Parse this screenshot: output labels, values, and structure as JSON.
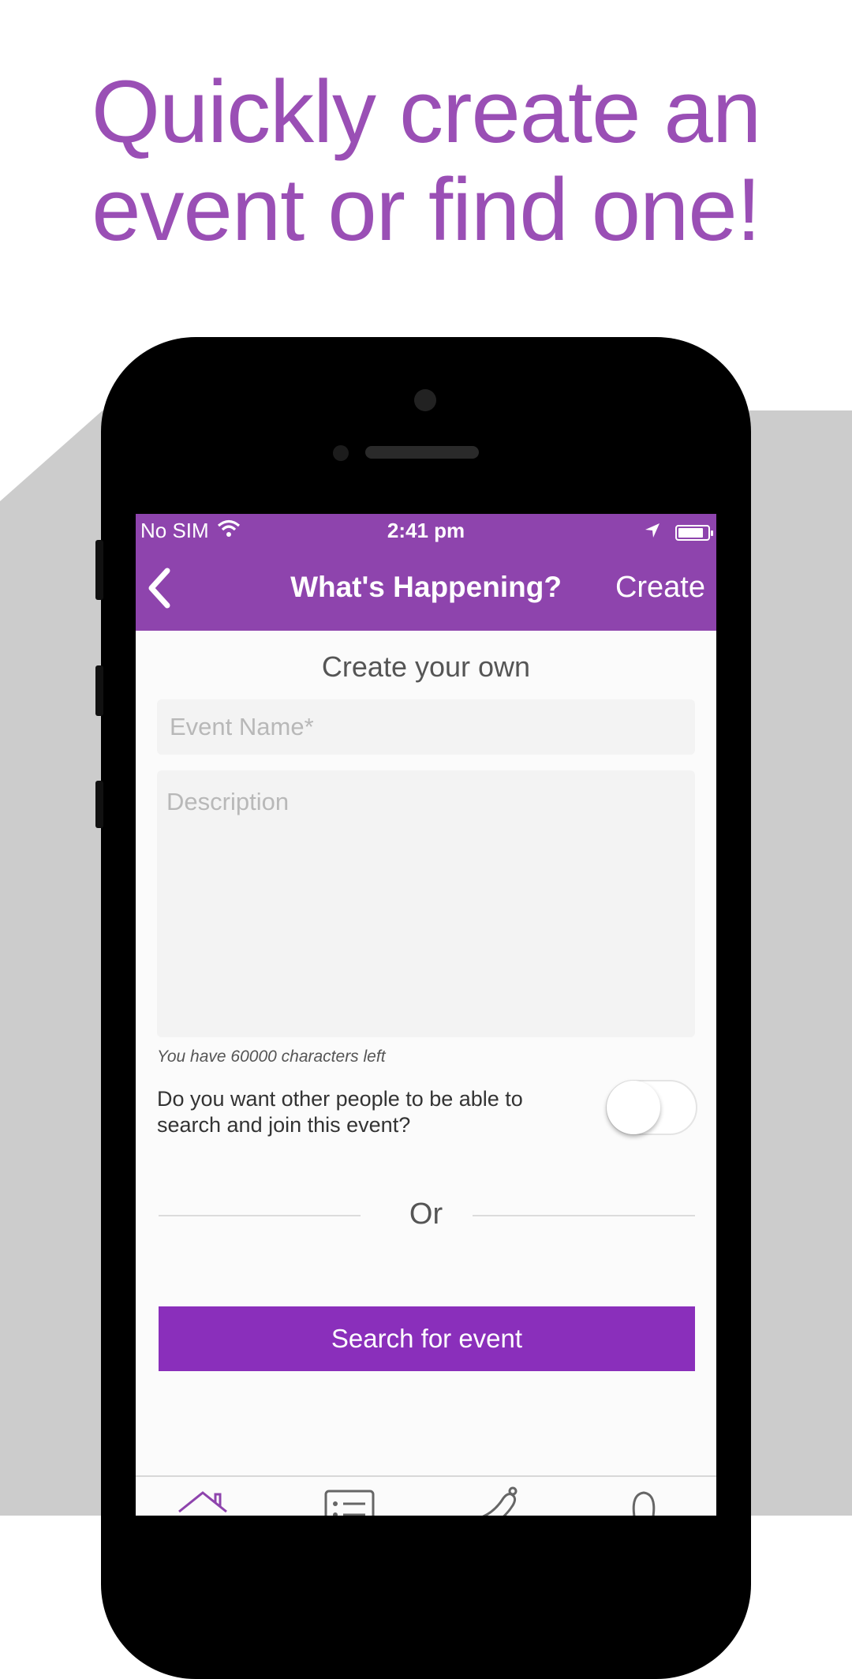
{
  "headline": {
    "line1": "Quickly create an",
    "line2": "event or find one!"
  },
  "colors": {
    "brand": "#8e44ad",
    "button": "#8a2fbb",
    "headline": "#9a4fb5"
  },
  "status_bar": {
    "carrier": "No SIM",
    "time": "2:41 pm",
    "battery_level": 0.85,
    "icons": [
      "wifi-icon",
      "location-arrow-icon",
      "battery-icon"
    ]
  },
  "nav": {
    "back_icon": "chevron-left-icon",
    "title": "What's Happening?",
    "create_label": "Create"
  },
  "form": {
    "section_title": "Create your own",
    "event_name_placeholder": "Event Name*",
    "description_placeholder": "Description",
    "chars_left": "You have 60000 characters left",
    "public_question": "Do you want other people to be able to search and join this event?",
    "public_toggle_on": false
  },
  "divider_label": "Or",
  "search_button_label": "Search for event",
  "tabbar": {
    "tabs": [
      "home-icon",
      "list-icon",
      "bell-icon",
      "profile-icon"
    ]
  }
}
